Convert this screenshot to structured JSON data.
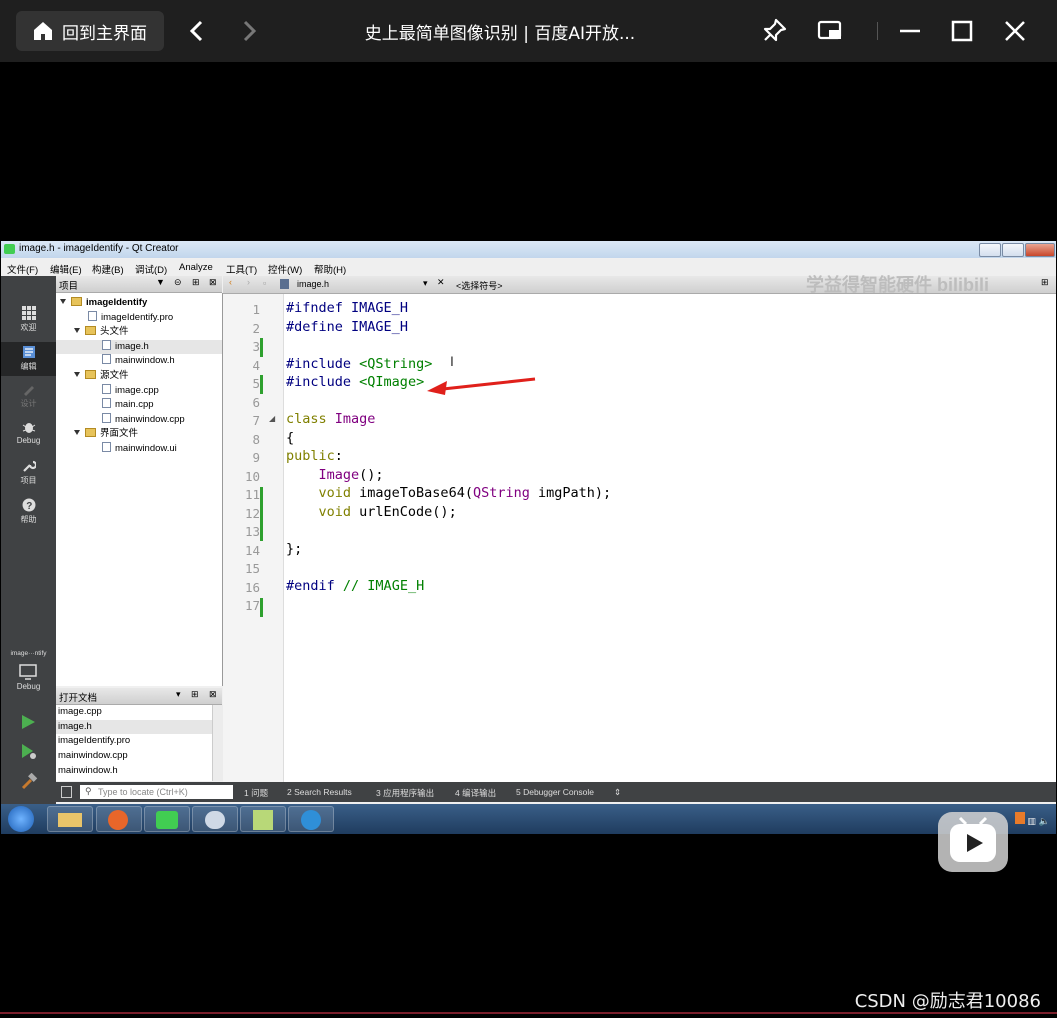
{
  "player": {
    "home_label": "回到主界面",
    "title": "史上最简单图像识别 | 百度AI开放...",
    "watermark": "学益得智能硬件 bilibili",
    "footer_credit": "CSDN @励志君10086"
  },
  "qt": {
    "window_title": "image.h - imageIdentify - Qt Creator",
    "menu": [
      "文件(F)",
      "编辑(E)",
      "构建(B)",
      "调试(D)",
      "Analyze",
      "工具(T)",
      "控件(W)",
      "帮助(H)"
    ],
    "modes": [
      "欢迎",
      "编辑",
      "设计",
      "Debug",
      "项目",
      "帮助"
    ],
    "kit_label": "image···ntify",
    "kit_mode": "Debug",
    "project_panel_title": "项目",
    "tree": {
      "root": "imageIdentify",
      "pro": "imageIdentify.pro",
      "headers_folder": "头文件",
      "header_1": "image.h",
      "header_2": "mainwindow.h",
      "sources_folder": "源文件",
      "source_1": "image.cpp",
      "source_2": "main.cpp",
      "source_3": "mainwindow.cpp",
      "forms_folder": "界面文件",
      "form_1": "mainwindow.ui"
    },
    "open_docs_title": "打开文档",
    "open_docs": [
      "image.cpp",
      "image.h",
      "imageIdentify.pro",
      "mainwindow.cpp",
      "mainwindow.h"
    ],
    "editor_file": "image.h",
    "symbol_selector": "<选择符号>",
    "locate_placeholder": "Type to locate (Ctrl+K)",
    "output_tabs": [
      "1 问题",
      "2 Search Results",
      "3 应用程序输出",
      "4 编译输出",
      "5 Debugger Console"
    ],
    "code_lines": [
      "1",
      "2",
      "3",
      "4",
      "5",
      "6",
      "7",
      "8",
      "9",
      "10",
      "11",
      "12",
      "13",
      "14",
      "15",
      "16",
      "17"
    ]
  },
  "colors": {
    "keyword": "#808000",
    "preprocessor": "#000080",
    "string": "#008000",
    "type": "#800080",
    "annotation_arrow": "#e0201b"
  }
}
